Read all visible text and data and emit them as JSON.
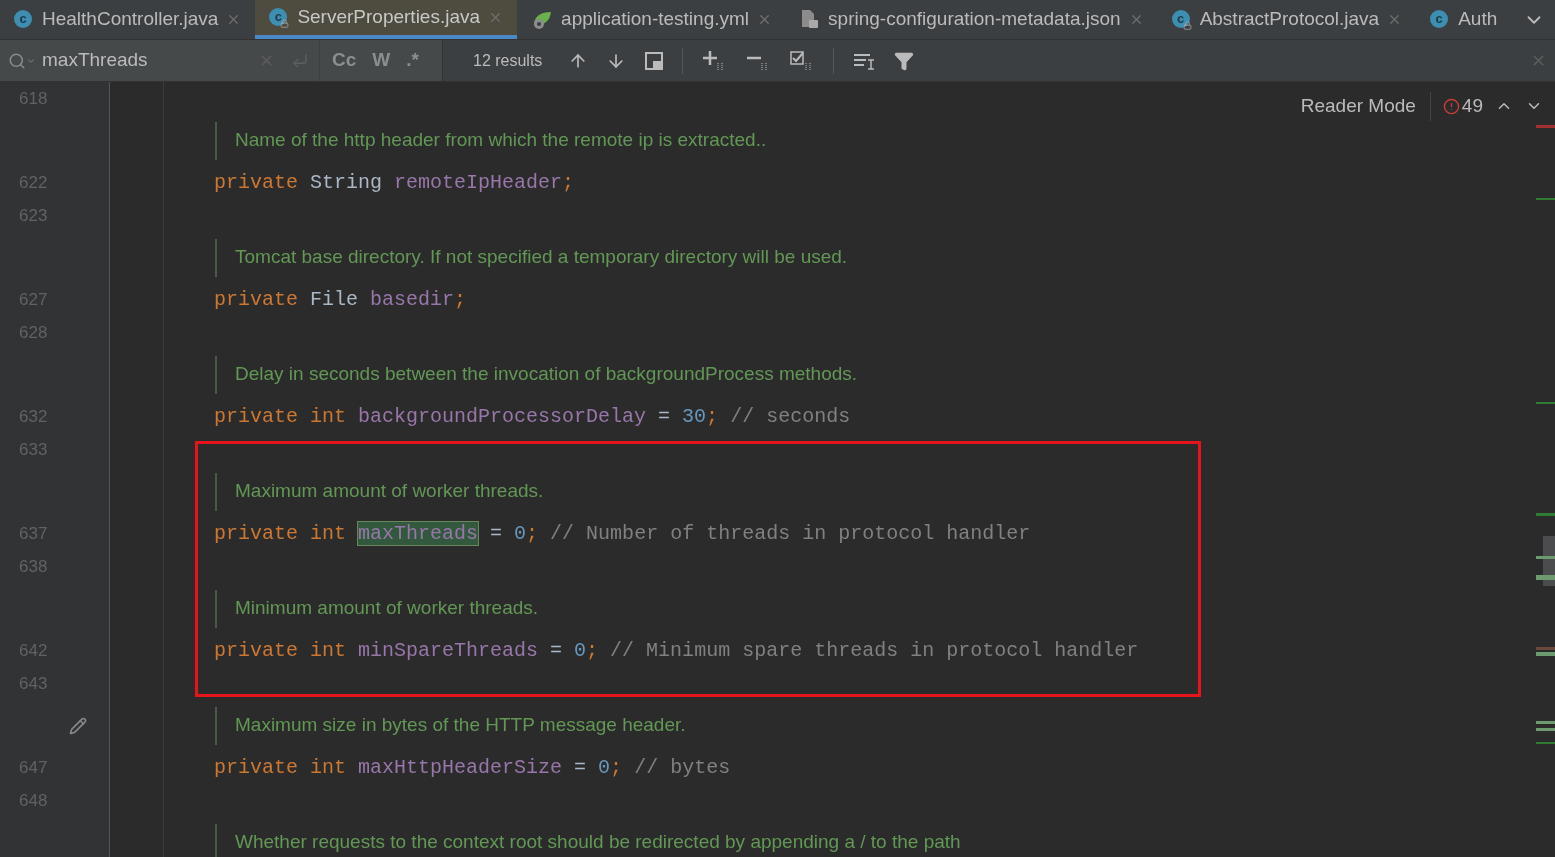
{
  "tabs": [
    {
      "kind": "class",
      "icon_text": "c",
      "label": "HealthController.java",
      "selected": false,
      "closable": true
    },
    {
      "kind": "class-locked",
      "icon_text": "c",
      "label": "ServerProperties.java",
      "selected": true,
      "closable": true
    },
    {
      "kind": "spring",
      "label": "application-testing.yml",
      "selected": false,
      "closable": true
    },
    {
      "kind": "json",
      "label": "spring-configuration-metadata.json",
      "selected": false,
      "closable": true
    },
    {
      "kind": "class-locked",
      "icon_text": "c",
      "label": "AbstractProtocol.java",
      "selected": false,
      "closable": true
    },
    {
      "kind": "class",
      "icon_text": "c",
      "label": "Auth",
      "selected": false,
      "closable": false
    }
  ],
  "search": {
    "value": "maxThreads",
    "options": [
      {
        "label": "Cc",
        "on": false
      },
      {
        "label": "W",
        "on": false
      },
      {
        "label": ".*",
        "on": false
      }
    ],
    "results": "12 results"
  },
  "editor": {
    "reader_mode": "Reader Mode",
    "problems": "49",
    "sections": [
      {
        "highlighted": false,
        "rows": [
          {
            "kind": "line",
            "number": "618"
          },
          {
            "kind": "doc",
            "text": "Name of the http header from which the remote ip is extracted.."
          },
          {
            "kind": "line",
            "number": "622",
            "tokens": [
              {
                "kind": "keyword",
                "text": "private "
              },
              {
                "kind": "plain",
                "text": "String "
              },
              {
                "kind": "field",
                "text": "remoteIpHeader"
              },
              {
                "kind": "keyword",
                "text": ";"
              }
            ]
          },
          {
            "kind": "line",
            "number": "623"
          },
          {
            "kind": "doc",
            "text": "Tomcat base directory. If not specified a temporary directory will be used."
          },
          {
            "kind": "line",
            "number": "627",
            "tokens": [
              {
                "kind": "keyword",
                "text": "private "
              },
              {
                "kind": "plain",
                "text": "File "
              },
              {
                "kind": "field",
                "text": "basedir"
              },
              {
                "kind": "keyword",
                "text": ";"
              }
            ]
          },
          {
            "kind": "line",
            "number": "628"
          },
          {
            "kind": "doc",
            "text": "Delay in seconds between the invocation of backgroundProcess methods."
          },
          {
            "kind": "line",
            "number": "632",
            "tokens": [
              {
                "kind": "keyword",
                "text": "private "
              },
              {
                "kind": "keyword",
                "text": "int "
              },
              {
                "kind": "field",
                "text": "backgroundProcessorDelay"
              },
              {
                "kind": "plain",
                "text": " = "
              },
              {
                "kind": "number",
                "text": "30"
              },
              {
                "kind": "keyword",
                "text": ";"
              },
              {
                "kind": "comment",
                "text": " // seconds"
              }
            ]
          }
        ]
      },
      {
        "highlighted": true,
        "rows": [
          {
            "kind": "line",
            "number": "633"
          },
          {
            "kind": "doc",
            "text": "Maximum amount of worker threads."
          },
          {
            "kind": "line",
            "number": "637",
            "tokens": [
              {
                "kind": "keyword",
                "text": "private "
              },
              {
                "kind": "keyword",
                "text": "int "
              },
              {
                "kind": "match",
                "text": "maxThreads"
              },
              {
                "kind": "plain",
                "text": " = "
              },
              {
                "kind": "number",
                "text": "0"
              },
              {
                "kind": "keyword",
                "text": ";"
              },
              {
                "kind": "comment",
                "text": " // Number of threads in protocol handler"
              }
            ]
          },
          {
            "kind": "line",
            "number": "638"
          },
          {
            "kind": "doc",
            "text": "Minimum amount of worker threads."
          },
          {
            "kind": "line",
            "number": "642",
            "tokens": [
              {
                "kind": "keyword",
                "text": "private "
              },
              {
                "kind": "keyword",
                "text": "int "
              },
              {
                "kind": "field",
                "text": "minSpareThreads"
              },
              {
                "kind": "plain",
                "text": " = "
              },
              {
                "kind": "number",
                "text": "0"
              },
              {
                "kind": "keyword",
                "text": ";"
              },
              {
                "kind": "comment",
                "text": " // Minimum spare threads in protocol handler"
              }
            ]
          },
          {
            "kind": "line",
            "number": "643"
          }
        ]
      },
      {
        "highlighted": false,
        "rows": [
          {
            "kind": "doc",
            "text": "Maximum size in bytes of the HTTP message header.",
            "edit_mark": true
          },
          {
            "kind": "line",
            "number": "647",
            "tokens": [
              {
                "kind": "keyword",
                "text": "private "
              },
              {
                "kind": "keyword",
                "text": "int "
              },
              {
                "kind": "field",
                "text": "maxHttpHeaderSize"
              },
              {
                "kind": "plain",
                "text": " = "
              },
              {
                "kind": "number",
                "text": "0"
              },
              {
                "kind": "keyword",
                "text": ";"
              },
              {
                "kind": "comment",
                "text": " // bytes"
              }
            ]
          },
          {
            "kind": "line",
            "number": "648"
          },
          {
            "kind": "doc",
            "text": "Whether requests to the context root should be redirected by appending a / to the path"
          }
        ]
      }
    ]
  }
}
